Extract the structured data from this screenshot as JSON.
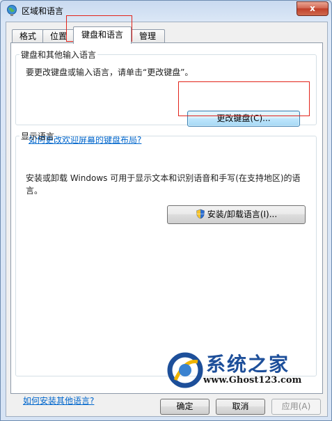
{
  "window": {
    "title": "区域和语言",
    "close_label": "x"
  },
  "tabs": [
    {
      "label": "格式"
    },
    {
      "label": "位置"
    },
    {
      "label": "键盘和语言"
    },
    {
      "label": "管理"
    }
  ],
  "keyboards_group": {
    "legend": "键盘和其他输入语言",
    "description": "要更改键盘或输入语言，请单击“更改键盘”。",
    "change_button": "更改键盘(C)...",
    "welcome_link": "如何更改欢迎屏幕的键盘布局?"
  },
  "display_group": {
    "legend": "显示语言",
    "description_line1": "安装或卸载 Windows 可用于显示文本和识别语音和手写(在支持地区)的语",
    "description_line2": "言。",
    "install_button": "安装/卸载语言(I)..."
  },
  "footer_link": "如何安装其他语言?",
  "buttons": {
    "ok": "确定",
    "cancel": "取消",
    "apply": "应用(A)"
  },
  "watermark": {
    "brand": "系统之家",
    "url": "www.Ghost123.com"
  },
  "colors": {
    "annotation": "#e2231a",
    "link": "#0066cc"
  },
  "icons": [
    "globe-icon",
    "close-icon",
    "uac-shield-icon"
  ]
}
